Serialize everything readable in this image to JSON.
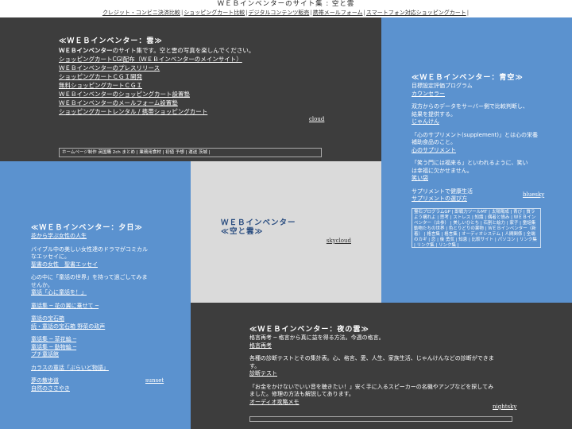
{
  "header": {
    "site_title": "ＷＥＢインベンターのサイト集 : 空と雲",
    "nav": [
      "クレジット・コンビニ決済比較",
      "ショッピングカート比較",
      "デジタルコンテンツ販売",
      "携帯メールフォーム",
      "スマートフォン対応ショッピングカート"
    ]
  },
  "cloud": {
    "title": "≪ＷＥＢインベンター：雲≫",
    "intro_bold": "ＷＥＢインベンター",
    "intro_rest": "のサイト集です。空と雲の写真を楽しんでください。",
    "lines": [
      "ショッピングカートCGI配布（ＷＥＢインベンターのメインサイト）",
      "ＷＥＢインベンターのプレスリリース",
      "ショッピングカートＣＧＩ開発",
      "無料ショッピングカートＣＧＩ",
      "ＷＥＢインベンターのショッピングカート設置塾",
      "ＷＥＢインベンターのメールフォーム設置塾",
      "ショッピングカートレンタル / 携帯ショッピングカート"
    ],
    "signature": "cloud",
    "links": "ホームページ制作 英国購 2ch まとめ | 業務用食材 | 初値 予想 | 運送 茨城 |"
  },
  "blue": {
    "title": "≪ＷＥＢインベンター：青空≫",
    "lines": [
      "目標設定評価プログラム",
      "カウンセラー",
      "",
      "双方からのデータをサーバー側で比較判断し、",
      "結果を提供する。",
      "じゃんけん",
      "",
      "「心のサプリメント(supplement)」とは心の栄養",
      "補助食品のこと。",
      "心のサプリメント",
      "",
      "「笑う門には福来る」といわれるように、笑い",
      "は幸福に欠かせません。",
      "笑い袋",
      "",
      "サプリメントで健康生活",
      "サプリメントの選び方"
    ],
    "signature": "bluesky",
    "links": "霊石プログラムGP | 即戦力ツールMT | 太陽陽成 | 青び | 質ラよう構れよ | 思考 | ストレス | 知識 | 偶者と憤み | ＷＥＢインベンター（古参） | 美しいひとち | 石割と絵力 | 家子 | 童話集 動物たちの世界 | 色とりどりの果物 | ＷＥＢインベンター（新着） | 格言集 | 格言集 | オーディオシステム | 人間関係 | 全端のカギ | 恋 | 後 勇気 | 知恵 | 比較サイト | パソコン | リンク集 | リンク集 | リンク集 |"
  },
  "sunset": {
    "title": "≪ＷＥＢインベンター：夕日≫",
    "lines": [
      "花から学ぶ女性の人生",
      "",
      "バイブル中の美しい女性達のドラマがコミカル",
      "なエッセイに。",
      "聖書の女性　聖書エッセイ",
      "",
      "心の中に「童話の世界」を持って過ごしてみま",
      "せんか。",
      "童話「心に童話を！」",
      "",
      "童話集 ─ 花の翼に乗せて ─",
      "",
      "童話の宝石箱",
      "続・童話の宝石箱 野菜の政声",
      "",
      "童話集 ─ 草花編 ─",
      "童話集 ─ 動物編 ─",
      "プチ童話館",
      "",
      "カラスの童話「ぶらいど物語」",
      "",
      "夢の散歩道",
      "自然のささやき"
    ],
    "signature": "sunset"
  },
  "center": {
    "title_line1": "ＷＥＢインベンター",
    "title_line2": "≪空と雲≫",
    "signature": "skycloud"
  },
  "night": {
    "title": "≪ＷＥＢインベンター：夜の雲≫",
    "lines": [
      "格言再考 ─ 格言から真に益を得る方法。今週の格言。",
      "格言再考",
      "",
      "各種の診断テストとその集計表。心、格言、愛、人生、家族生活、じゃんけんなどの診断ができま",
      "す。",
      "診断テスト",
      "",
      "「お金をかけないでいい音を聴きたい！」安く手に入るスピーカーの名機やアンプなどを探してみ",
      "ました。修理の方法も解説してあります。",
      "オーディオ攻略メモ"
    ],
    "signature": "nightsky"
  }
}
